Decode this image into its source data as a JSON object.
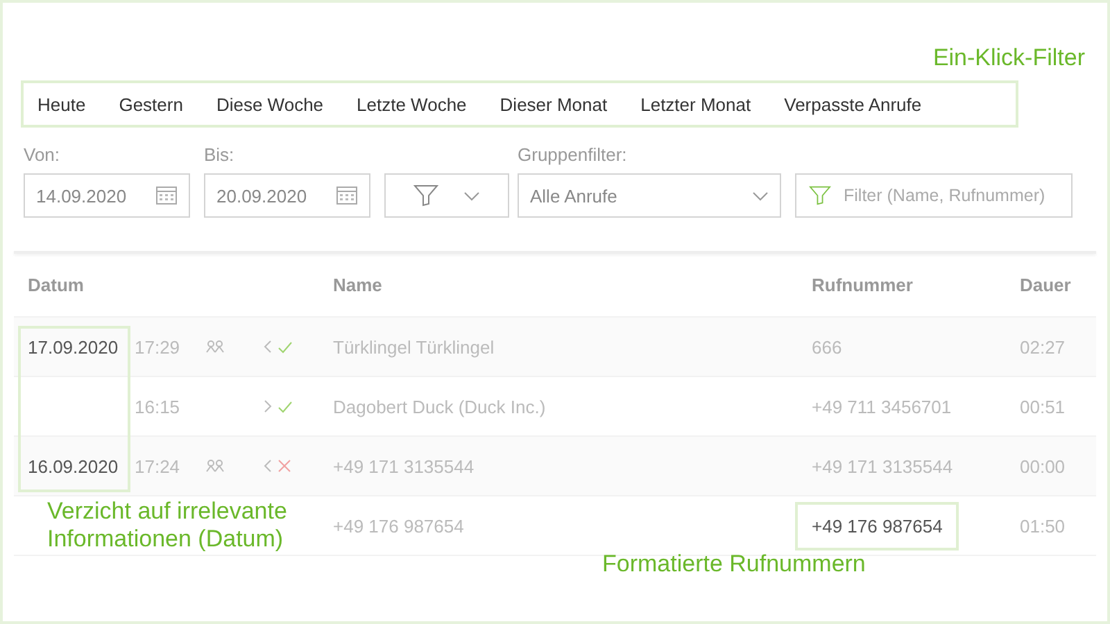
{
  "callout_title": "Ein-Klick-Filter",
  "quick_filters": [
    {
      "label": "Heute"
    },
    {
      "label": "Gestern"
    },
    {
      "label": "Diese Woche"
    },
    {
      "label": "Letzte Woche"
    },
    {
      "label": "Dieser Monat"
    },
    {
      "label": "Letzter Monat"
    },
    {
      "label": "Verpasste Anrufe"
    }
  ],
  "from": {
    "label": "Von:",
    "value": "14.09.2020"
  },
  "to": {
    "label": "Bis:",
    "value": "20.09.2020"
  },
  "group_filter": {
    "label": "Gruppenfilter:",
    "value": "Alle Anrufe"
  },
  "search": {
    "placeholder": "Filter (Name, Rufnummer)"
  },
  "table": {
    "columns": [
      "Datum",
      "Name",
      "Rufnummer",
      "Dauer"
    ],
    "date_highlight": true,
    "rows": [
      {
        "date": "17.09.2020",
        "time": "17:29",
        "group": true,
        "incoming": true,
        "answered": true,
        "name": "Türklingel Türklingel",
        "number": "666",
        "duration": "02:27",
        "number_highlight": false
      },
      {
        "time": "16:15",
        "group": false,
        "incoming": false,
        "answered": true,
        "name": "Dagobert Duck (Duck Inc.)",
        "number": "+49 711 3456701",
        "duration": "00:51",
        "number_highlight": false
      },
      {
        "date": "16.09.2020",
        "time": "17:24",
        "group": true,
        "incoming": true,
        "answered": false,
        "name": "+49 171 3135544",
        "number": "+49 171 3135544",
        "duration": "00:00",
        "number_highlight": false
      },
      {
        "group": false,
        "name": "+49 176 987654",
        "number": "+49 176 987654",
        "duration": "01:50",
        "number_highlight": true
      }
    ]
  },
  "annotations": [
    {
      "text": "Verzicht auf irrelevante Informationen (Datum)",
      "kind": "date"
    },
    {
      "text": "Formatierte Rufnummern",
      "kind": "number"
    }
  ]
}
